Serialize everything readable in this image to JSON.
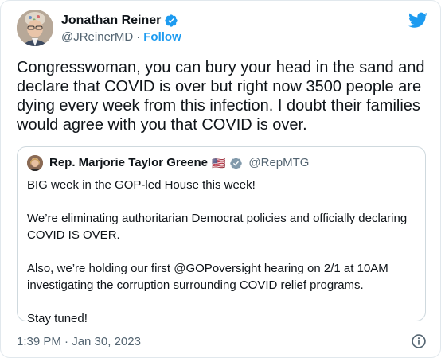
{
  "author": {
    "name": "Jonathan Reiner",
    "handle": "@JReinerMD",
    "separator": "·",
    "follow_label": "Follow",
    "verified": true
  },
  "tweet": {
    "text": "Congresswoman, you can bury your head in the sand and\ndeclare that COVID is over but right now 3500 people are\ndying every week from this infection. I doubt their families\nwould agree with you that COVID is over.",
    "timestamp": "1:39 PM · Jan 30, 2023"
  },
  "quoted": {
    "name": "Rep. Marjorie Taylor Greene",
    "flag": "🇺🇸",
    "handle": "@RepMTG",
    "verified": true,
    "paragraphs": [
      "BIG week in the GOP-led House this week!",
      "We’re eliminating authoritarian Democrat policies and officially declaring COVID IS OVER.",
      "Also, we’re holding our first @GOPoversight hearing on 2/1 at 10AM investigating the corruption surrounding COVID relief programs.",
      "Stay tuned!"
    ]
  },
  "icons": {
    "brand": "twitter-bird-icon",
    "verified": "verified-badge-icon",
    "info": "info-icon"
  },
  "colors": {
    "accent": "#1d9bf0",
    "text": "#0f1419",
    "muted": "#536471",
    "border": "#cfd9de",
    "verified_quote": "#829aab"
  }
}
